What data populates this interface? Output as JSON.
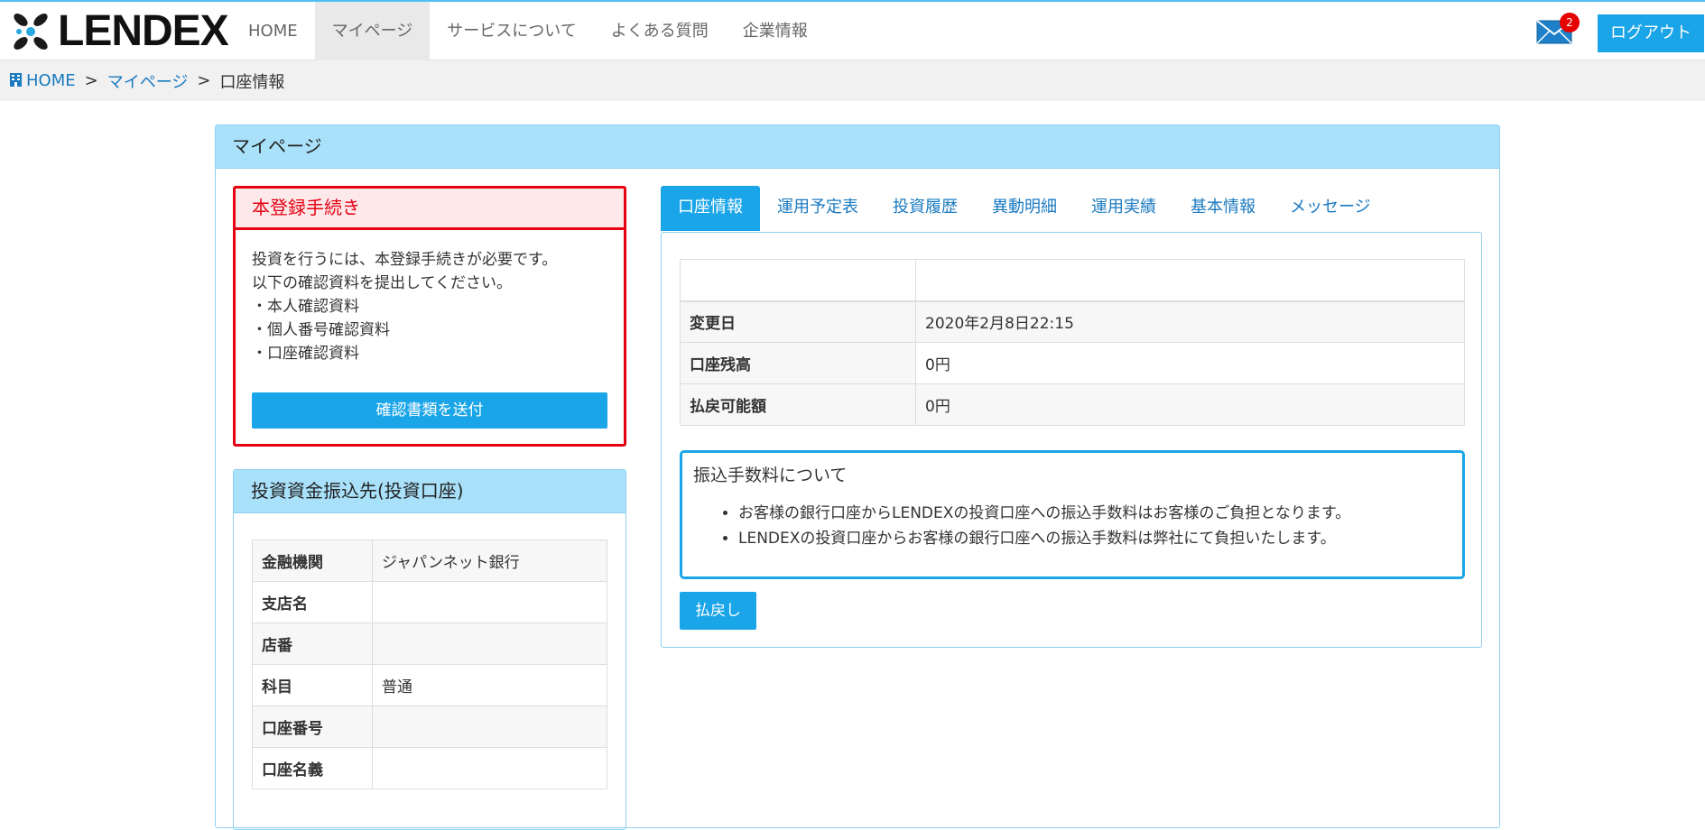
{
  "header": {
    "logo_text": "LENDEX",
    "nav": [
      {
        "label": "HOME"
      },
      {
        "label": "マイページ"
      },
      {
        "label": "サービスについて"
      },
      {
        "label": "よくある質問"
      },
      {
        "label": "企業情報"
      }
    ],
    "mail_badge": "2",
    "logout_label": "ログアウト"
  },
  "breadcrumb": {
    "home": "HOME",
    "separator": ">",
    "mypage": "マイページ",
    "current": "口座情報"
  },
  "panel": {
    "title": "マイページ"
  },
  "registration": {
    "title": "本登録手続き",
    "lines": [
      "投資を行うには、本登録手続きが必要です。",
      "以下の確認資料を提出してください。",
      "・本人確認資料",
      "・個人番号確認資料",
      "・口座確認資料"
    ],
    "button": "確認書類を送付"
  },
  "transfer": {
    "title": "投資資金振込先(投資口座)",
    "rows": [
      {
        "label": "金融機関",
        "value": "ジャパンネット銀行"
      },
      {
        "label": "支店名",
        "value": ""
      },
      {
        "label": "店番",
        "value": ""
      },
      {
        "label": "科目",
        "value": "普通"
      },
      {
        "label": "口座番号",
        "value": ""
      },
      {
        "label": "口座名義",
        "value": ""
      }
    ]
  },
  "tabs": [
    {
      "label": "口座情報",
      "active": true
    },
    {
      "label": "運用予定表"
    },
    {
      "label": "投資履歴"
    },
    {
      "label": "異動明細"
    },
    {
      "label": "運用実績"
    },
    {
      "label": "基本情報"
    },
    {
      "label": "メッセージ"
    }
  ],
  "account": {
    "rows": [
      {
        "label": "変更日",
        "value": "2020年2月8日22:15"
      },
      {
        "label": "口座残高",
        "value": "0円"
      },
      {
        "label": "払戻可能額",
        "value": "0円"
      }
    ]
  },
  "notice": {
    "title": "振込手数料について",
    "items": [
      "お客様の銀行口座からLENDEXの投資口座への振込手数料はお客様のご負担となります。",
      "LENDEXの投資口座からお客様の銀行口座への振込手数料は弊社にて負担いたします。"
    ]
  },
  "refund_button": "払戻し",
  "colors": {
    "accent": "#1aa5e8",
    "panel_header": "#a9e1fb",
    "alert": "#e60012",
    "link": "#1a7ac0"
  }
}
